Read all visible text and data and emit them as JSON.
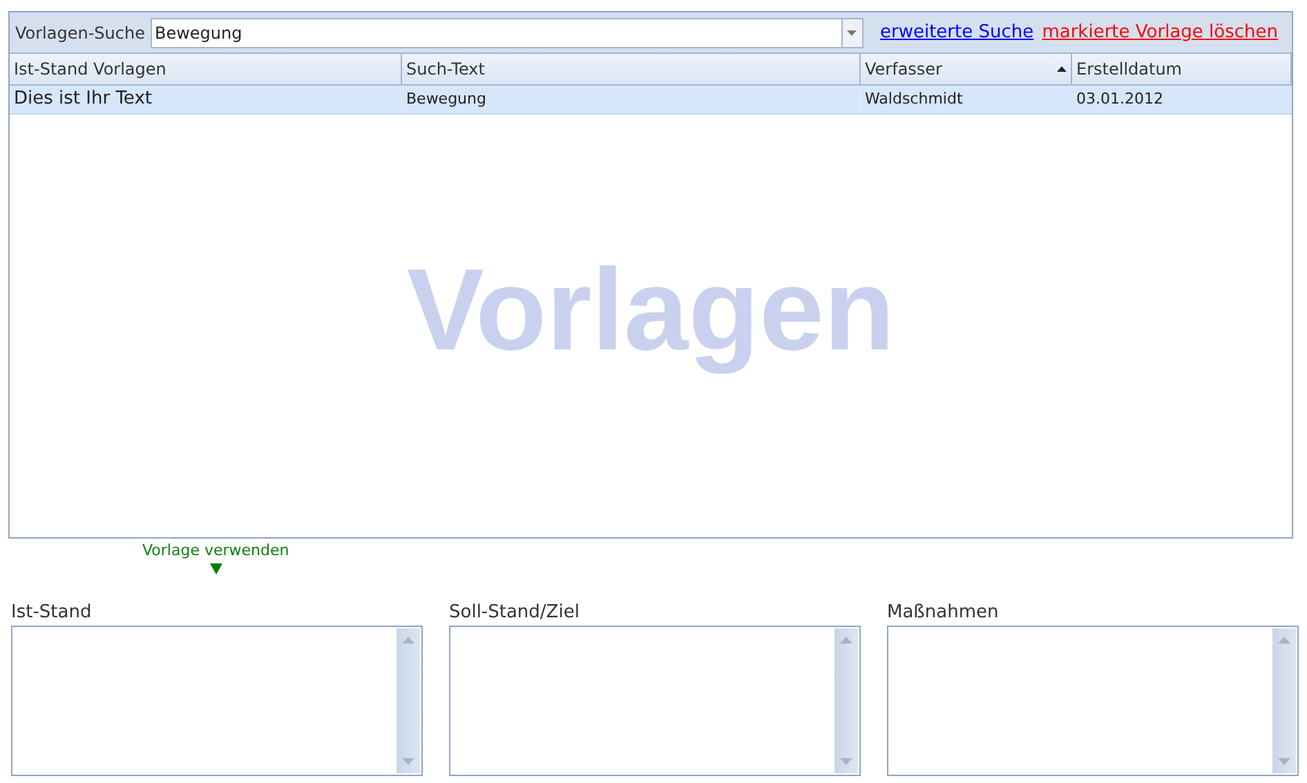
{
  "search": {
    "label": "Vorlagen-Suche",
    "value": "Bewegung"
  },
  "links": [
    {
      "text": "erweiterte Suche",
      "kind": "normal"
    },
    {
      "text": "markierte Vorlage löschen",
      "kind": "danger"
    }
  ],
  "table": {
    "columns": [
      {
        "label": "Ist-Stand Vorlagen",
        "sorted": false
      },
      {
        "label": "Such-Text",
        "sorted": false
      },
      {
        "label": "Verfasser",
        "sorted": true
      },
      {
        "label": "Erstelldatum",
        "sorted": false
      }
    ],
    "rows": [
      {
        "cells": [
          "Dies ist Ihr Text",
          "Bewegung",
          "Waldschmidt",
          "03.01.2012"
        ],
        "selected": true
      }
    ],
    "watermark": "Vorlagen"
  },
  "use_template": "Vorlage verwenden",
  "fields": [
    {
      "label": "Ist-Stand"
    },
    {
      "label": "Soll-Stand/Ziel"
    },
    {
      "label": "Maßnahmen"
    }
  ]
}
